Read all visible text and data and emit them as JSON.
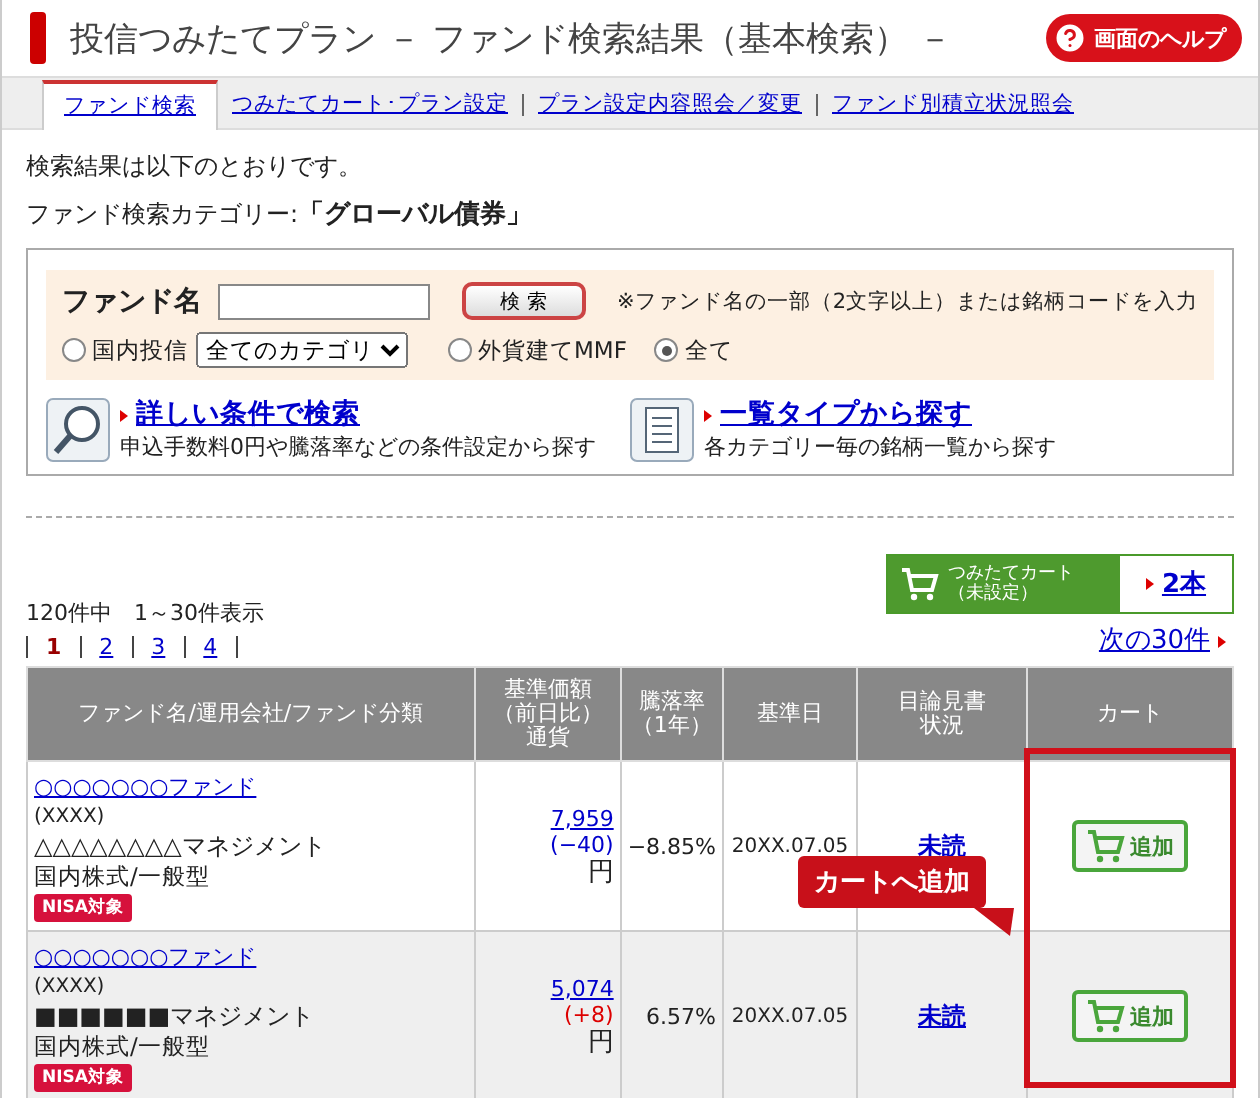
{
  "header": {
    "title": "投信つみたてプラン － ファンド検索結果（基本検索） －",
    "help_button": "画面のヘルプ"
  },
  "tabs": [
    {
      "label": "ファンド検索",
      "selected": true
    },
    {
      "label": "つみたてカート･プラン設定",
      "selected": false
    },
    {
      "label": "プラン設定内容照会／変更",
      "selected": false
    },
    {
      "label": "ファンド別積立状況照会",
      "selected": false
    }
  ],
  "intro": "検索結果は以下のとおりです。",
  "category": {
    "label": "ファンド検索カテゴリー:",
    "value": "「グローバル債券」"
  },
  "search": {
    "label": "ファンド名",
    "button": "検 索",
    "hint": "※ファンド名の一部（2文字以上）または銘柄コードを入力",
    "options": [
      {
        "kind": "radio-select",
        "label": "国内投信",
        "selected": false,
        "select_value": "全てのカテゴリ"
      },
      {
        "kind": "radio",
        "label": "外貨建てMMF",
        "selected": false
      },
      {
        "kind": "radio",
        "label": "全て",
        "selected": true
      }
    ]
  },
  "links": [
    {
      "kind": "search",
      "title": "詳しい条件で検索",
      "description": "申込手数料0円や騰落率などの条件設定から探す"
    },
    {
      "kind": "list",
      "title": "一覧タイプから探す",
      "description": "各カテゴリー毎の銘柄一覧から探す"
    }
  ],
  "cart": {
    "label": "つみたてカート",
    "status": "（未設定）",
    "count": "2本"
  },
  "results": {
    "summary": "120件中　1～30件表示",
    "next": "次の30件",
    "pages": [
      {
        "label": "1",
        "selected": true
      },
      {
        "label": "2",
        "selected": false
      },
      {
        "label": "3",
        "selected": false
      },
      {
        "label": "4",
        "selected": false
      }
    ]
  },
  "table": {
    "columns": [
      {
        "lines": [
          "ファンド名/運用会社/ファンド分類"
        ]
      },
      {
        "lines": [
          "基準価額",
          "（前日比）",
          "通貨"
        ]
      },
      {
        "lines": [
          "騰落率",
          "（1年）"
        ]
      },
      {
        "lines": [
          "基準日"
        ]
      },
      {
        "lines": [
          "目論見書",
          "状況"
        ]
      },
      {
        "lines": [
          "カート"
        ]
      }
    ],
    "rows": [
      {
        "fund_name": "○○○○○○○ファンド",
        "code": "(XXXX)",
        "company": "△△△△△△△△マネジメント",
        "category": "国内株式/一般型",
        "badge": "NISA対象",
        "price": "7,959",
        "change": "(−40)",
        "color": "#0000cc",
        "currency": "円",
        "return": "−8.85%",
        "date": "20XX.07.05",
        "prospectus": "未読",
        "cart_button": "追加"
      },
      {
        "fund_name": "○○○○○○○ファンド",
        "code": "(XXXX)",
        "company": "■■■■■■マネジメント",
        "category": "国内株式/一般型",
        "badge": "NISA対象",
        "price": "5,074",
        "change": "(+8)",
        "color": "#dd0000",
        "currency": "円",
        "return": "6.57%",
        "date": "20XX.07.05",
        "prospectus": "未読",
        "cart_button": "追加"
      }
    ]
  },
  "callout": "カートへ追加"
}
